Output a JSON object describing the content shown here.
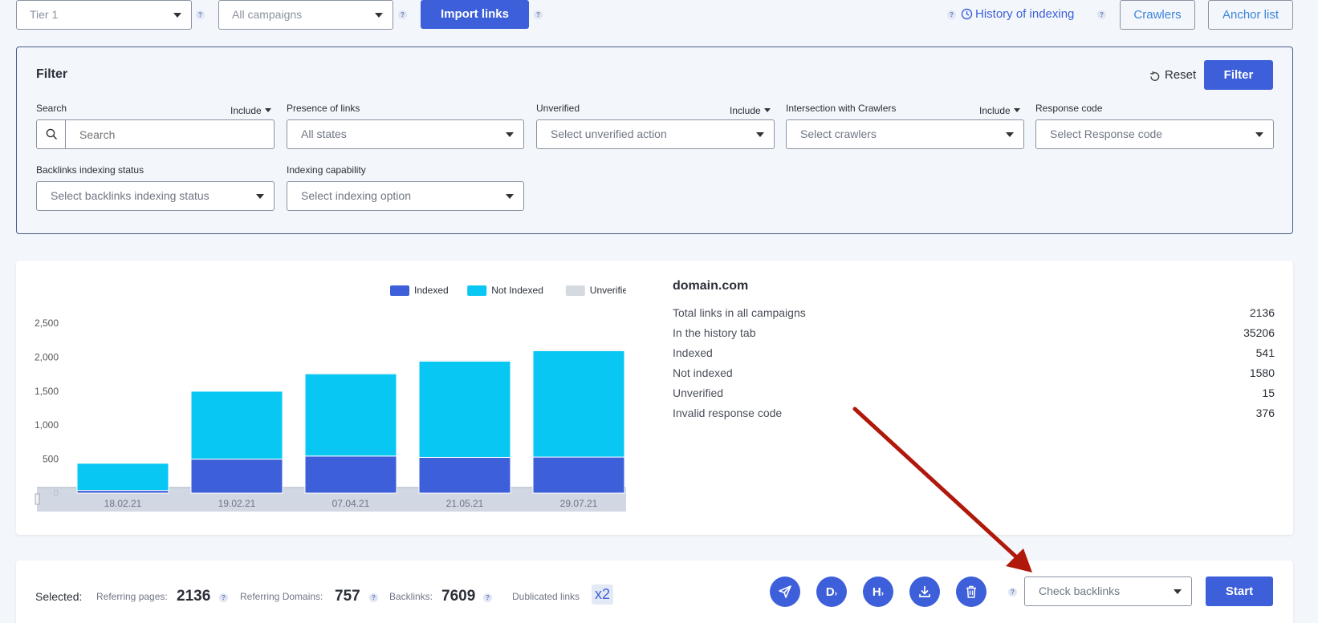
{
  "topbar": {
    "tier_select": "Tier 1",
    "campaigns_select": "All campaigns",
    "import_label": "Import links",
    "history_label": "History of indexing",
    "crawlers_label": "Crawlers",
    "anchor_label": "Anchor list"
  },
  "filter": {
    "title": "Filter",
    "reset_label": "Reset",
    "filter_label": "Filter",
    "search_label": "Search",
    "search_placeholder": "Search",
    "include_label": "Include",
    "presence_label": "Presence of links",
    "presence_value": "All states",
    "unverified_label": "Unverified",
    "unverified_value": "Select unverified action",
    "crawlers_label": "Intersection with Crawlers",
    "crawlers_value": "Select crawlers",
    "response_label": "Response code",
    "response_value": "Select Response code",
    "backlinks_status_label": "Backlinks indexing status",
    "backlinks_status_value": "Select backlinks indexing status",
    "capability_label": "Indexing capability",
    "capability_value": "Select indexing option"
  },
  "chart_data": {
    "type": "bar",
    "stacked": true,
    "categories": [
      "18.02.21",
      "19.02.21",
      "07.04.21",
      "21.05.21",
      "29.07.21"
    ],
    "series": [
      {
        "name": "Indexed",
        "color": "#3d5fd9",
        "values": [
          40,
          500,
          545,
          525,
          530
        ]
      },
      {
        "name": "Not Indexed",
        "color": "#08c7f2",
        "values": [
          400,
          1000,
          1210,
          1415,
          1565
        ]
      },
      {
        "name": "Unverified",
        "color": "#d5d9e0",
        "values": [
          2,
          2,
          15,
          15,
          15
        ]
      }
    ],
    "yticks": [
      "0",
      "500",
      "1,000",
      "1,500",
      "2,000",
      "2,500"
    ],
    "ylim": [
      0,
      2500
    ],
    "legend": "top-right"
  },
  "stats": {
    "domain": "domain.com",
    "rows": [
      {
        "label": "Total links in all campaigns",
        "value": "2136"
      },
      {
        "label": "In the history tab",
        "value": "35206"
      },
      {
        "label": "Indexed",
        "value": "541"
      },
      {
        "label": "Not indexed",
        "value": "1580"
      },
      {
        "label": "Unverified",
        "value": "15"
      },
      {
        "label": "Invalid response code",
        "value": "376"
      }
    ]
  },
  "bottom": {
    "selected_label": "Selected:",
    "ref_pages_label": "Referring pages:",
    "ref_pages_value": "2136",
    "ref_domains_label": "Referring Domains:",
    "ref_domains_value": "757",
    "backlinks_label": "Backlinks:",
    "backlinks_value": "7609",
    "dup_label": "Dublicated links",
    "dup_value": "x2",
    "action_select": "Check backlinks",
    "start_label": "Start",
    "icon_d": "D",
    "icon_h": "H"
  },
  "colors": {
    "primary": "#3d5fd9",
    "annotation_arrow": "#b0180c"
  }
}
